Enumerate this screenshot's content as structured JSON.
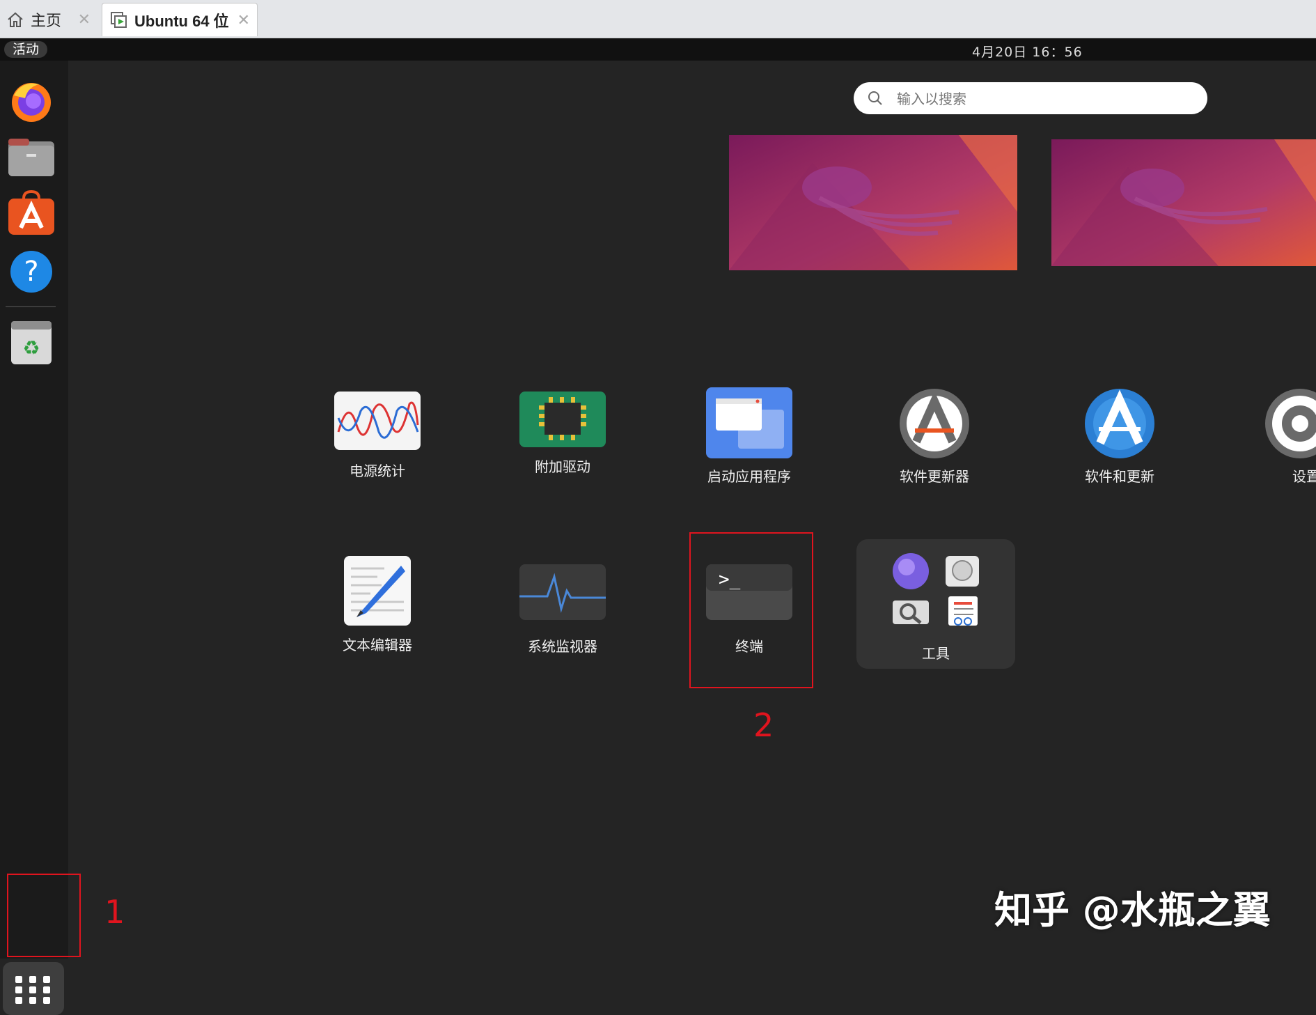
{
  "tabs": [
    {
      "label": "主页",
      "icon": "home-icon"
    },
    {
      "label": "Ubuntu 64 位",
      "icon": "vm-icon"
    }
  ],
  "topbar": {
    "activities": "活动",
    "clock": "4月20日  16：56"
  },
  "dock": {
    "items": [
      "firefox",
      "files",
      "app-center",
      "help",
      "trash"
    ],
    "show_apps_icon": "app-grid-icon"
  },
  "search": {
    "placeholder": "输入以搜索"
  },
  "apps_row1": [
    {
      "label": "电源统计",
      "icon": "power-statistics-icon"
    },
    {
      "label": "附加驱动",
      "icon": "additional-drivers-icon"
    },
    {
      "label": "启动应用程序",
      "icon": "startup-applications-icon"
    },
    {
      "label": "软件更新器",
      "icon": "software-updater-icon"
    },
    {
      "label": "软件和更新",
      "icon": "software-properties-icon"
    },
    {
      "label": "设置",
      "icon": "settings-icon"
    }
  ],
  "apps_row2": [
    {
      "label": "文本编辑器",
      "icon": "text-editor-icon"
    },
    {
      "label": "系统监视器",
      "icon": "system-monitor-icon"
    },
    {
      "label": "终端",
      "icon": "terminal-icon"
    },
    {
      "label": "工具",
      "icon": "utilities-folder-icon"
    }
  ],
  "annotations": [
    "1",
    "2"
  ],
  "watermark": "知乎 @水瓶之翼",
  "colors": {
    "accent_red": "#e0141e",
    "background": "#242424",
    "dock": "#1b1b1b"
  }
}
